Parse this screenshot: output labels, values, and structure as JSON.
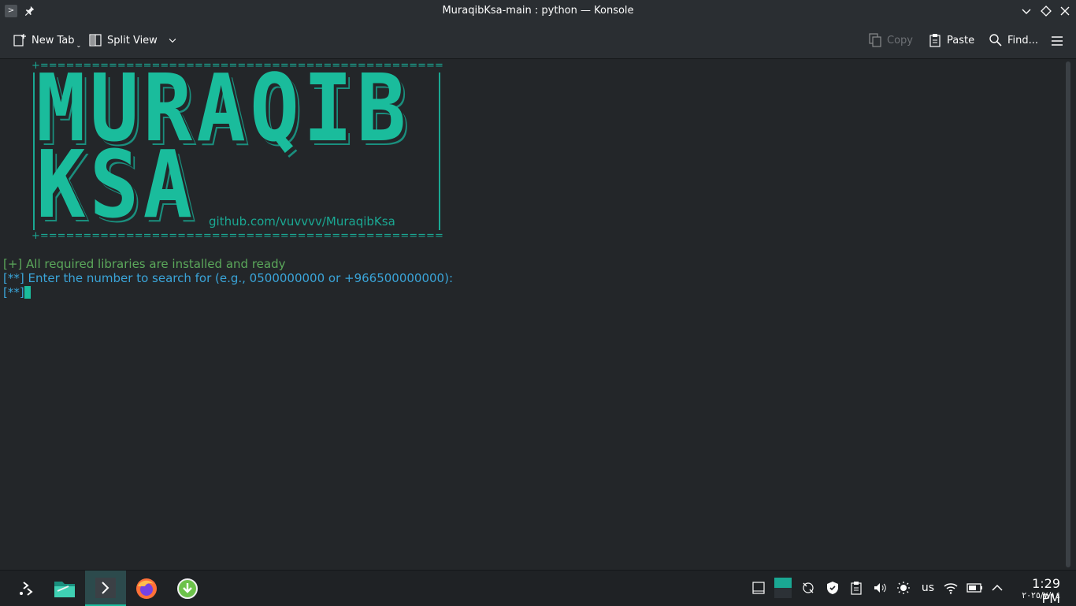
{
  "window": {
    "title": "MuraqibKsa-main : python — Konsole"
  },
  "toolbar": {
    "new_tab": "New Tab",
    "split_view": "Split View",
    "copy": "Copy",
    "paste": "Paste",
    "find": "Find..."
  },
  "terminal": {
    "banner_border": "+=========================================================+",
    "banner_line1": "MURAQIB",
    "banner_line2": "KSA",
    "banner_url": "github.com/vuvvvv/MuraqibKsa",
    "status_line": "[+] All required libraries are installed and ready",
    "prompt_line": "[**] Enter the number to search for (e.g., 0500000000 or +966500000000):",
    "input_prefix": "[**]",
    "colors": {
      "accent": "#1abc9c",
      "ok": "#5ba85b",
      "prompt": "#3aa4d8"
    }
  },
  "taskbar": {
    "apps": [
      "launcher-icon",
      "file-manager-icon",
      "konsole-icon",
      "firefox-icon",
      "update-icon"
    ],
    "tray": {
      "keyboard_layout": "us"
    },
    "clock": {
      "time": "1:29 PM",
      "date": "٢٠٢٥/٧/١٤"
    }
  }
}
